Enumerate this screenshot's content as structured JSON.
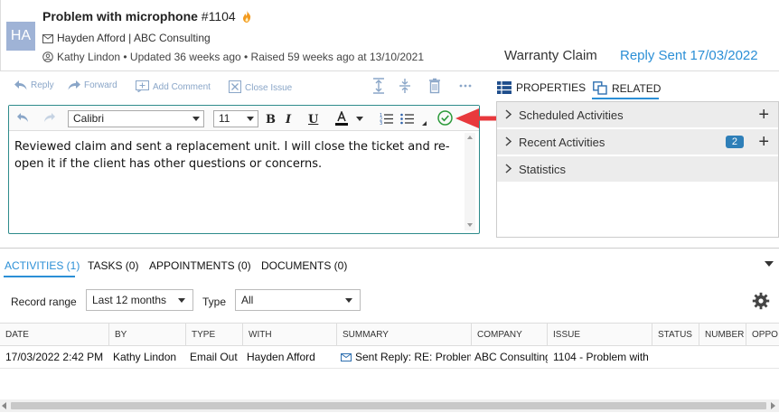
{
  "header": {
    "avatar_initials": "HA",
    "title": "Problem with microphone",
    "ticket_number": "#1104",
    "contact_line": "Hayden Afford | ABC Consulting",
    "meta_line": "Kathy Lindon • Updated 36 weeks ago • Raised 59 weeks ago at 13/10/2021",
    "type": "Warranty Claim",
    "status": "Reply Sent 17/03/2022"
  },
  "toolbar": {
    "reply": "Reply",
    "forward": "Forward",
    "add_comment": "Add Comment",
    "close_issue": "Close Issue"
  },
  "editor": {
    "font": "Calibri",
    "size": "11",
    "text": "Reviewed claim and sent a replacement unit. I will close the ticket and re-open it if the client has other questions or concerns."
  },
  "right_panel": {
    "tabs": [
      "PROPERTIES",
      "RELATED"
    ],
    "sections": [
      {
        "label": "Scheduled Activities"
      },
      {
        "label": "Recent Activities",
        "badge": "2"
      },
      {
        "label": "Statistics"
      }
    ]
  },
  "bottom": {
    "tabs": [
      "ACTIVITIES (1)",
      "TASKS (0)",
      "APPOINTMENTS (0)",
      "DOCUMENTS (0)"
    ],
    "filters": {
      "record_range_label": "Record range",
      "record_range_value": "Last 12 months",
      "type_label": "Type",
      "type_value": "All"
    },
    "columns": [
      "DATE",
      "BY",
      "TYPE",
      "WITH",
      "SUMMARY",
      "COMPANY",
      "ISSUE",
      "STATUS",
      "NUMBER",
      "OPPO"
    ],
    "rows": [
      [
        "17/03/2022 2:42 PM",
        "Kathy Lindon",
        "Email Out",
        "Hayden Afford",
        "Sent Reply: RE: Problem",
        "ABC Consulting",
        "1104 - Problem with",
        "",
        "",
        ""
      ]
    ]
  },
  "colors": {
    "accent_blue": "#2b8fd6",
    "editor_border": "#2e8b8b",
    "arrow_red": "#e8393d",
    "badge_blue": "#2e7fb8"
  }
}
